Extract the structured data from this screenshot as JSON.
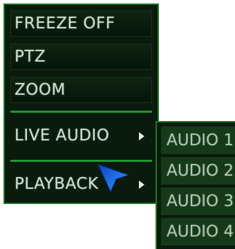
{
  "menu": {
    "items": [
      {
        "label": "FREEZE OFF"
      },
      {
        "label": "PTZ"
      },
      {
        "label": "ZOOM"
      },
      {
        "label": "LIVE AUDIO"
      },
      {
        "label": "PLAYBACK"
      }
    ]
  },
  "audio_submenu": {
    "items": [
      {
        "label": "AUDIO 1"
      },
      {
        "label": "AUDIO 2"
      },
      {
        "label": "AUDIO 3"
      },
      {
        "label": "AUDIO 4"
      }
    ]
  },
  "colors": {
    "menu_bg": "#0a1a0c",
    "border": "#1f7a2a",
    "separator": "#1f9a30",
    "submenu_item_bg": "#143a1a",
    "cursor": "#1e6ff0"
  },
  "icons": {
    "submenu_arrow": "triangle-right-icon",
    "pointer": "mouse-pointer-icon"
  }
}
